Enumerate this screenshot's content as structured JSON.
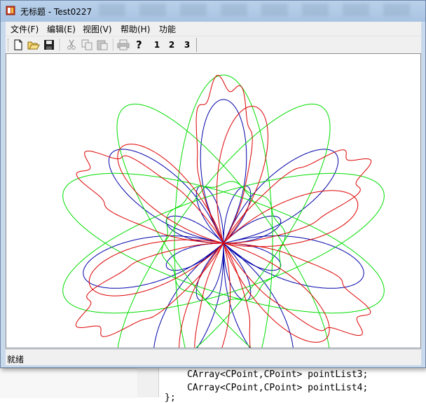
{
  "window": {
    "title": "无标题 - Test0227"
  },
  "menu": {
    "items": [
      {
        "label": "文件(F)"
      },
      {
        "label": "编辑(E)"
      },
      {
        "label": "视图(V)"
      },
      {
        "label": "帮助(H)"
      },
      {
        "label": "功能"
      }
    ]
  },
  "toolbar": {
    "buttons": [
      {
        "icon": "new-file-icon"
      },
      {
        "icon": "open-folder-icon"
      },
      {
        "icon": "save-icon"
      },
      {
        "icon": "cut-icon"
      },
      {
        "icon": "copy-icon"
      },
      {
        "icon": "paste-icon"
      },
      {
        "icon": "print-icon"
      },
      {
        "icon": "help-icon"
      }
    ],
    "numbers": [
      "1",
      "2",
      "3"
    ]
  },
  "drawing": {
    "curves": [
      {
        "color": "#0000aa",
        "name": "blue"
      },
      {
        "color": "#00dd00",
        "name": "green"
      },
      {
        "color": "#dd0000",
        "name": "red"
      }
    ]
  },
  "status": {
    "text": "就绪"
  },
  "background_code": {
    "lines": [
      "CArray<CPoint,CPoint> pointList3;",
      "CArray<CPoint,CPoint> pointList4;",
      "};"
    ]
  }
}
